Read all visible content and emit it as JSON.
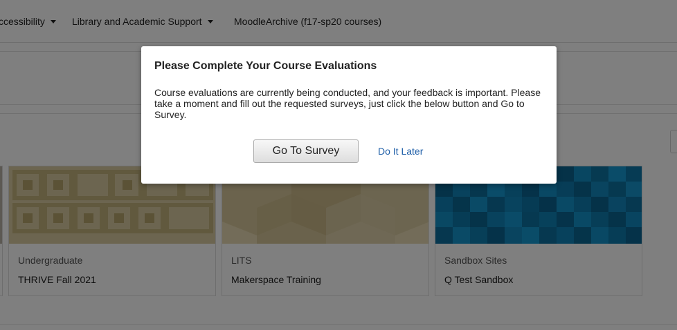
{
  "nav": {
    "items": [
      {
        "label": "ccessibility",
        "has_caret": true
      },
      {
        "label": "Library and Academic Support",
        "has_caret": true
      },
      {
        "label": "MoodleArchive (f17-sp20 courses)",
        "has_caret": false
      }
    ]
  },
  "courses": [
    {
      "category": "Undergraduate",
      "title": "THRIVE Fall 2021",
      "image_pattern": "beige-squares"
    },
    {
      "category": "LITS",
      "title": "Makerspace Training",
      "image_pattern": "beige-hexagons"
    },
    {
      "category": "Sandbox Sites",
      "title": "Q Test Sandbox",
      "image_pattern": "blue-mosaic"
    }
  ],
  "modal": {
    "title": "Please Complete Your Course Evaluations",
    "body": "Course evaluations are currently being conducted, and your feedback is important. Please take a moment and fill out the requested surveys, just click the below button and Go to Survey.",
    "primary_label": "Go To Survey",
    "secondary_label": "Do It Later"
  },
  "colors": {
    "overlay": "rgba(0,0,0,0.5)",
    "link": "#1f5fa8",
    "beige": "#d6c89f",
    "blue": "#0e7fb0"
  }
}
